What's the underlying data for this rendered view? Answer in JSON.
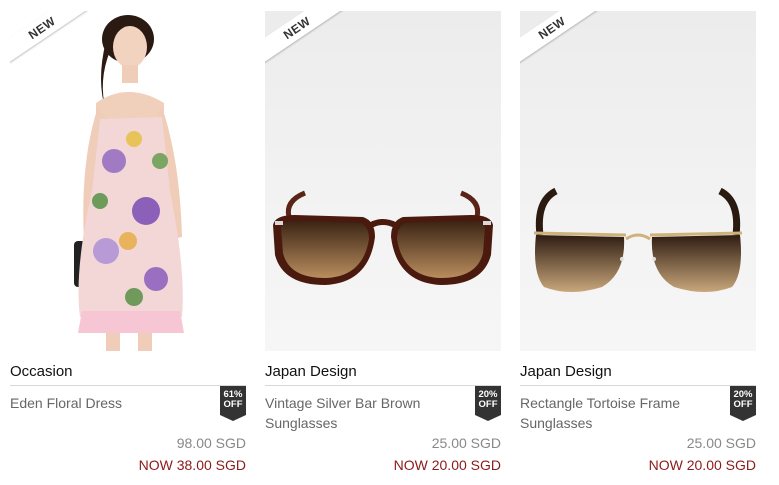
{
  "products": [
    {
      "ribbon": "NEW",
      "image": "floral-strapless-dress-model",
      "brand": "Occasion",
      "name": "Eden Floral Dress",
      "discount_pct": "61%",
      "discount_label": "OFF",
      "original_price": "98.00 SGD",
      "now_price": "NOW 38.00 SGD"
    },
    {
      "ribbon": "NEW",
      "image": "brown-cat-eye-sunglasses",
      "brand": "Japan Design",
      "name": "Vintage Silver Bar Brown Sunglasses",
      "discount_pct": "20%",
      "discount_label": "OFF",
      "original_price": "25.00 SGD",
      "now_price": "NOW 20.00 SGD"
    },
    {
      "ribbon": "NEW",
      "image": "rimless-tortoise-sunglasses",
      "brand": "Japan Design",
      "name": "Rectangle Tortoise Frame Sunglasses",
      "discount_pct": "20%",
      "discount_label": "OFF",
      "original_price": "25.00 SGD",
      "now_price": "NOW 20.00 SGD"
    }
  ],
  "colors": {
    "now_price": "#8b1a1a",
    "badge": "#333333",
    "divider": "#d8d8d8"
  }
}
